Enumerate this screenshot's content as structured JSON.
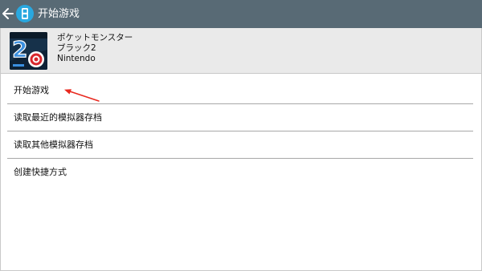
{
  "actionbar": {
    "title": "开始游戏",
    "back_icon": "arrow-left-icon",
    "app_icon": "ds-console-icon",
    "background": "#586a75"
  },
  "game": {
    "title_line1": "ポケットモンスター",
    "title_line2": "ブラック2",
    "publisher": "Nintendo",
    "cover_icon": "pokemon-black-2-cover"
  },
  "menu": {
    "items": [
      {
        "label": "开始游戏"
      },
      {
        "label": "读取最近的模拟器存档"
      },
      {
        "label": "读取其他模拟器存档"
      },
      {
        "label": "创建快捷方式"
      }
    ]
  },
  "annotation": {
    "icon": "red-pointer-arrow",
    "color": "#e8281e"
  }
}
